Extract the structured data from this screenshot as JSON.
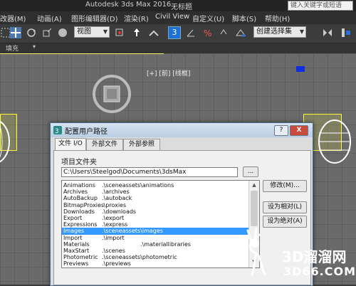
{
  "app": {
    "title": "Autodesk 3ds Max 2016",
    "subtitle": "无标题"
  },
  "search": {
    "placeholder": "键入关键字或短语"
  },
  "menubar": {
    "items": [
      "改器(M)",
      "动画(A)",
      "图形编辑器(D)",
      "渲染(R)",
      "Civil View",
      "自定义(U)",
      "脚本(S)",
      "帮助(H)"
    ]
  },
  "toolbar": {
    "view_combo": "视图",
    "selection_set_combo": "创建选择集",
    "snap_value": "3"
  },
  "ribbon": {
    "fill_label": "填充"
  },
  "viewport": {
    "label": "[+] [前] [线框]"
  },
  "dialog": {
    "title": "配置用户路径",
    "tabs": [
      "文件 I/O",
      "外部文件",
      "外部参照"
    ],
    "project_folder_label": "项目文件夹",
    "project_path": "C:\\Users\\Steelgod\\Documents\\3dsMax",
    "browse_label": "...",
    "paths": [
      {
        "name": "Animations",
        "path": ".\\sceneassets\\animations"
      },
      {
        "name": "Archives",
        "path": ".\\archives"
      },
      {
        "name": "AutoBackup",
        "path": ".\\autoback"
      },
      {
        "name": "BitmapProxies",
        "path": ".\\proxies"
      },
      {
        "name": "Downloads",
        "path": ".\\downloads"
      },
      {
        "name": "Export",
        "path": ".\\export"
      },
      {
        "name": "Expressions",
        "path": ".\\express"
      },
      {
        "name": "Images",
        "path": ".\\sceneassets\\images"
      },
      {
        "name": "Import",
        "path": ".\\import"
      },
      {
        "name": "Materials",
        "path": ".\\materiallibraries"
      },
      {
        "name": "MaxStart",
        "path": ".\\scenes"
      },
      {
        "name": "Photometric",
        "path": ".\\sceneassets\\photometric"
      },
      {
        "name": "Previews",
        "path": ".\\previews"
      }
    ],
    "selected_index": 7,
    "modify_button": "修改(M)...",
    "make_relative_button": "设为相对(L)",
    "make_absolute_button": "设为绝对(A)",
    "help_button": "?",
    "close_button": "X"
  },
  "watermark": {
    "brand": "3D溜溜网",
    "url": "3D66.COM"
  },
  "colors": {
    "selection": "#3399ff",
    "accent_blue": "#1e6fd6"
  }
}
